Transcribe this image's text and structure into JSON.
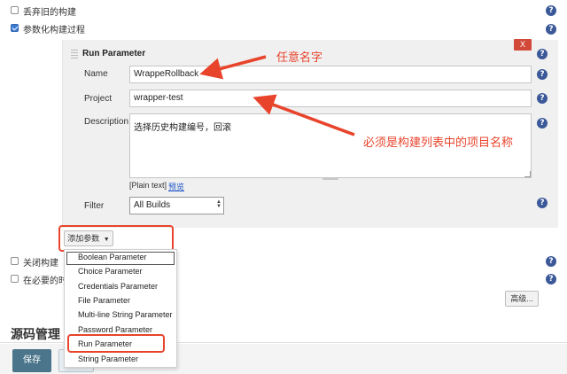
{
  "options": {
    "discard_old_builds": "丢弃旧的构建",
    "parameterized": "参数化构建过程",
    "disable_build": "关闭构建",
    "concurrent_build": "在必要的时"
  },
  "param_block": {
    "title": "Run Parameter",
    "delete_label": "X",
    "name_label": "Name",
    "name_value": "WrappeRollback",
    "project_label": "Project",
    "project_value": "wrapper-test",
    "description_label": "Description",
    "description_value": "选择历史构建编号，回滚",
    "plain_text": "[Plain text]",
    "preview_link": "预览",
    "filter_label": "Filter",
    "filter_value": "All Builds"
  },
  "add_param_button": "添加参数",
  "menu_items": [
    "Boolean Parameter",
    "Choice Parameter",
    "Credentials Parameter",
    "File Parameter",
    "Multi-line String Parameter",
    "Password Parameter",
    "Run Parameter",
    "String Parameter"
  ],
  "advanced_button": "高级...",
  "section_heading": "源码管理",
  "save_button": "保存",
  "help_glyph": "?",
  "annotations": {
    "any_name": "任意名字",
    "project_must_be": "必须是构建列表中的项目名称"
  },
  "colors": {
    "annotation_red": "#e8442c",
    "save_button_bg": "#4b758b",
    "help_icon_bg": "#3b5998",
    "delete_button_bg": "#d24939"
  }
}
